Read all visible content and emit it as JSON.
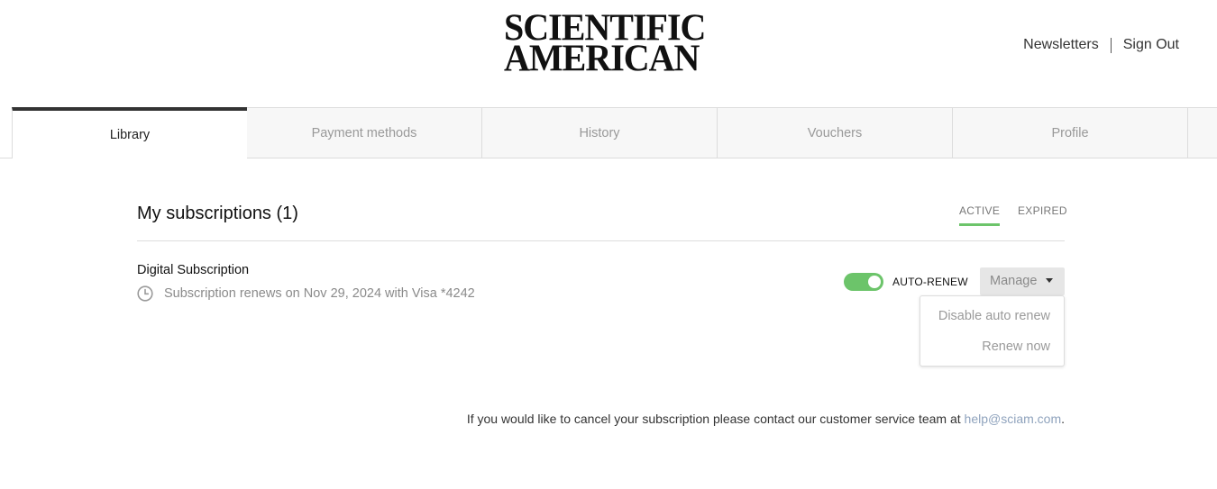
{
  "header": {
    "logo_line1": "SCIENTIFIC",
    "logo_line2": "AMERICAN",
    "nav": {
      "newsletters": "Newsletters",
      "sign_out": "Sign Out"
    }
  },
  "tabs": [
    {
      "label": "Library",
      "active": true
    },
    {
      "label": "Payment methods",
      "active": false
    },
    {
      "label": "History",
      "active": false
    },
    {
      "label": "Vouchers",
      "active": false
    },
    {
      "label": "Profile",
      "active": false
    }
  ],
  "subscriptions": {
    "title": "My subscriptions (1)",
    "filters": {
      "active": "ACTIVE",
      "expired": "EXPIRED",
      "selected": "ACTIVE"
    },
    "items": [
      {
        "name": "Digital Subscription",
        "renewal_text": "Subscription renews on Nov 29, 2024 with Visa *4242",
        "icon": "clock-icon",
        "auto_renew_label": "AUTO-RENEW",
        "auto_renew_on": true,
        "manage_label": "Manage",
        "menu": [
          "Disable auto renew",
          "Renew now"
        ]
      }
    ]
  },
  "footer": {
    "cancel_text": "If you would like to cancel your subscription please contact our customer service team at ",
    "email": "help@sciam.com",
    "suffix": "."
  },
  "colors": {
    "accent_green": "#6cc46a",
    "active_tab_border": "#333333",
    "email_link": "#8fa3bd"
  }
}
